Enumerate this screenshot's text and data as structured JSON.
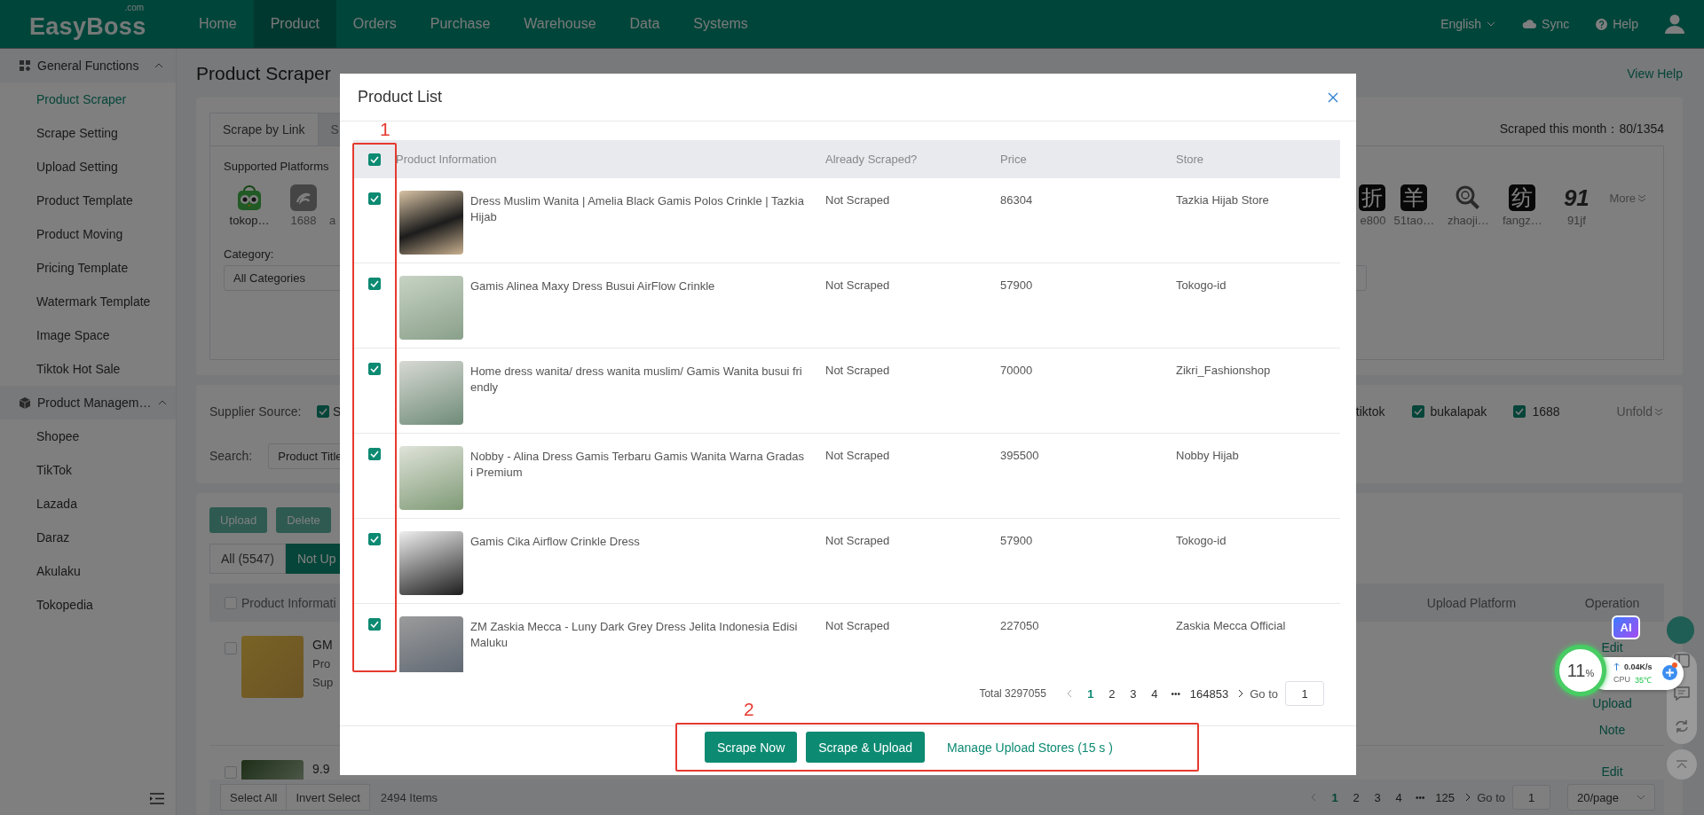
{
  "brand": {
    "name": "EasyBoss",
    "suffix": ".com"
  },
  "nav": [
    {
      "label": "Home",
      "selected": false
    },
    {
      "label": "Product",
      "selected": true
    },
    {
      "label": "Orders",
      "selected": false
    },
    {
      "label": "Purchase",
      "selected": false
    },
    {
      "label": "Warehouse",
      "selected": false
    },
    {
      "label": "Data",
      "selected": false
    },
    {
      "label": "Systems",
      "selected": false
    }
  ],
  "header_actions": {
    "language": "English",
    "sync": "Sync",
    "help": "Help"
  },
  "sidebar": {
    "groups": [
      {
        "label": "General Functions",
        "kind": "grid",
        "expanded": true,
        "items": [
          {
            "label": "Product Scraper",
            "selected": true
          },
          {
            "label": "Scrape Setting",
            "selected": false
          },
          {
            "label": "Upload Setting",
            "selected": false
          },
          {
            "label": "Product Template",
            "selected": false
          },
          {
            "label": "Product Moving",
            "selected": false
          },
          {
            "label": "Pricing Template",
            "selected": false
          },
          {
            "label": "Watermark Template",
            "selected": false
          },
          {
            "label": "Image Space",
            "selected": false
          },
          {
            "label": "Tiktok Hot Sale",
            "selected": false
          }
        ]
      },
      {
        "label": "Product Managem…",
        "kind": "cube",
        "expanded": true,
        "items": [
          {
            "label": "Shopee",
            "selected": false
          },
          {
            "label": "TikTok",
            "selected": false
          },
          {
            "label": "Lazada",
            "selected": false
          },
          {
            "label": "Daraz",
            "selected": false
          },
          {
            "label": "Akulaku",
            "selected": false
          },
          {
            "label": "Tokopedia",
            "selected": false
          }
        ]
      }
    ]
  },
  "page": {
    "title": "Product Scraper",
    "view_help": "View Help"
  },
  "scrape_card": {
    "tabs": [
      {
        "label": "Scrape by Link",
        "selected": true
      },
      {
        "label": "S",
        "selected": false
      }
    ],
    "scraped_this_month": "Scraped this month：80/1354",
    "platforms_label": "Supported Platforms",
    "platforms_left": [
      {
        "name": "tokop…",
        "kind": "owl"
      },
      {
        "name": "1688",
        "kind": "swirl"
      },
      {
        "name": "a",
        "kind": "none"
      }
    ],
    "platforms_right": [
      {
        "name": "e800",
        "kind": "glyph",
        "glyph": "折"
      },
      {
        "name": "51tao…",
        "kind": "glyph",
        "glyph": "羊"
      },
      {
        "name": "zhaoji…",
        "kind": "magnifier"
      },
      {
        "name": "fangz…",
        "kind": "glyph",
        "glyph": "纺"
      },
      {
        "name": "91jf",
        "kind": "text",
        "glyph": "91"
      }
    ],
    "more": "More",
    "category_label": "Category:",
    "category_value": "All Categories"
  },
  "filter_card": {
    "supplier_label": "Supplier Source:",
    "sources_left": [
      {
        "label": "S",
        "checked": true
      }
    ],
    "partial_source": "tiktok",
    "sources_right": [
      {
        "label": "bukalapak",
        "checked": true
      },
      {
        "label": "1688",
        "checked": true
      }
    ],
    "unfold": "Unfold",
    "search_label": "Search:",
    "search_type": "Product Title"
  },
  "products_card": {
    "actions": [
      "Upload",
      "Delete"
    ],
    "tabs": [
      {
        "label": "All (5547)",
        "selected": false
      },
      {
        "label": "Not Up",
        "selected": true
      }
    ],
    "header_checked": false,
    "column_left": "Product Informati",
    "columns_right": [
      "Upload Platform",
      "Operation"
    ],
    "rows": [
      {
        "checked": false,
        "title": "GM",
        "lines": [
          "Pro",
          "Sup"
        ],
        "operations": [
          "Edit",
          "Upload",
          "Note"
        ]
      },
      {
        "checked": false,
        "title": "9.9",
        "lines": [],
        "operations": [
          "Edit"
        ]
      }
    ],
    "select_all": "Select All",
    "invert_select": "Invert Select",
    "count": "2494 Items",
    "pagination": {
      "pages": [
        {
          "label": "1",
          "selected": true
        },
        {
          "label": "2",
          "selected": false
        },
        {
          "label": "3",
          "selected": false
        },
        {
          "label": "4",
          "selected": false
        }
      ],
      "ellipsis": "•••",
      "last": "125",
      "goto_label": "Go to",
      "goto_value": "1",
      "page_size": "20/page"
    }
  },
  "modal": {
    "title": "Product List",
    "columns": [
      "Product Information",
      "Already Scraped?",
      "Price",
      "Store"
    ],
    "select_all_checked": true,
    "rows": [
      {
        "checked": true,
        "title": "Dress Muslim Wanita | Amelia Black Gamis Polos Crinkle | Tazkia Hijab",
        "status": "Not Scraped",
        "price": "86304",
        "store": "Tazkia Hijab Store"
      },
      {
        "checked": true,
        "title": "Gamis Alinea Maxy Dress Busui AirFlow Crinkle",
        "status": "Not Scraped",
        "price": "57900",
        "store": "Tokogo-id"
      },
      {
        "checked": true,
        "title": "Home dress wanita/ dress wanita muslim/ Gamis Wanita busui friendly",
        "status": "Not Scraped",
        "price": "70000",
        "store": "Zikri_Fashionshop"
      },
      {
        "checked": true,
        "title": "Nobby - Alina Dress Gamis Terbaru Gamis Wanita Warna Gradasi Premium",
        "status": "Not Scraped",
        "price": "395500",
        "store": "Nobby Hijab"
      },
      {
        "checked": true,
        "title": "Gamis Cika Airflow Crinkle Dress",
        "status": "Not Scraped",
        "price": "57900",
        "store": "Tokogo-id"
      },
      {
        "checked": true,
        "title": "ZM Zaskia Mecca - Luny Dark Grey Dress Jelita Indonesia Edisi Maluku",
        "status": "Not Scraped",
        "price": "227050",
        "store": "Zaskia Mecca Official"
      }
    ],
    "total": "Total 3297055",
    "pagination": {
      "pages": [
        {
          "label": "1",
          "selected": true
        },
        {
          "label": "2",
          "selected": false
        },
        {
          "label": "3",
          "selected": false
        },
        {
          "label": "4",
          "selected": false
        }
      ],
      "ellipsis": "•••",
      "last": "164853",
      "goto_label": "Go to",
      "goto_value": "1"
    },
    "buttons": [
      "Scrape Now",
      "Scrape & Upload"
    ],
    "link": "Manage Upload Stores (15 s )"
  },
  "annotations": [
    {
      "label": "1"
    },
    {
      "label": "2"
    }
  ],
  "widget": {
    "ai": "AI",
    "percent": "11",
    "percent_unit": "%",
    "speed": "0.04K/s",
    "cpu_label": "CPU",
    "cpu_temp": "35℃"
  }
}
